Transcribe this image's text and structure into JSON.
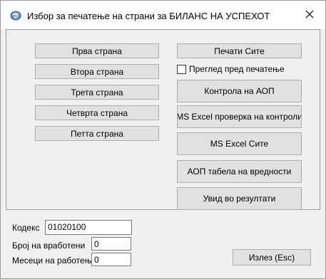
{
  "window": {
    "title": "Избор за печатење на страни за БИЛАНС НА УСПЕХОТ",
    "close_glyph": "✕"
  },
  "pages": {
    "first": "Прва страна",
    "second": "Втора страна",
    "third": "Трета страна",
    "fourth": "Четврта страна",
    "fifth": "Петта страна"
  },
  "actions": {
    "print_all": "Печати Сите",
    "preview_label": "Преглед пред печатење",
    "preview_checked": false,
    "aop_control": "Контрола на АОП",
    "excel_check": "MS Excel проверка на контроли",
    "excel_all": "MS Excel Сите",
    "aop_table": "АОП табела на вредности",
    "view_results": "Увид во резултати"
  },
  "form": {
    "code_label": "Кодекс",
    "code_value": "01020100",
    "employees_label": "Број на вработени",
    "employees_value": "0",
    "months_label": "Месеци на работење",
    "months_value": "0"
  },
  "footer": {
    "exit_label": "Излез (Esc)"
  },
  "colors": {
    "button_face": "#e1e1e1",
    "button_border": "#adadad",
    "window_bg": "#f0f0f0"
  }
}
